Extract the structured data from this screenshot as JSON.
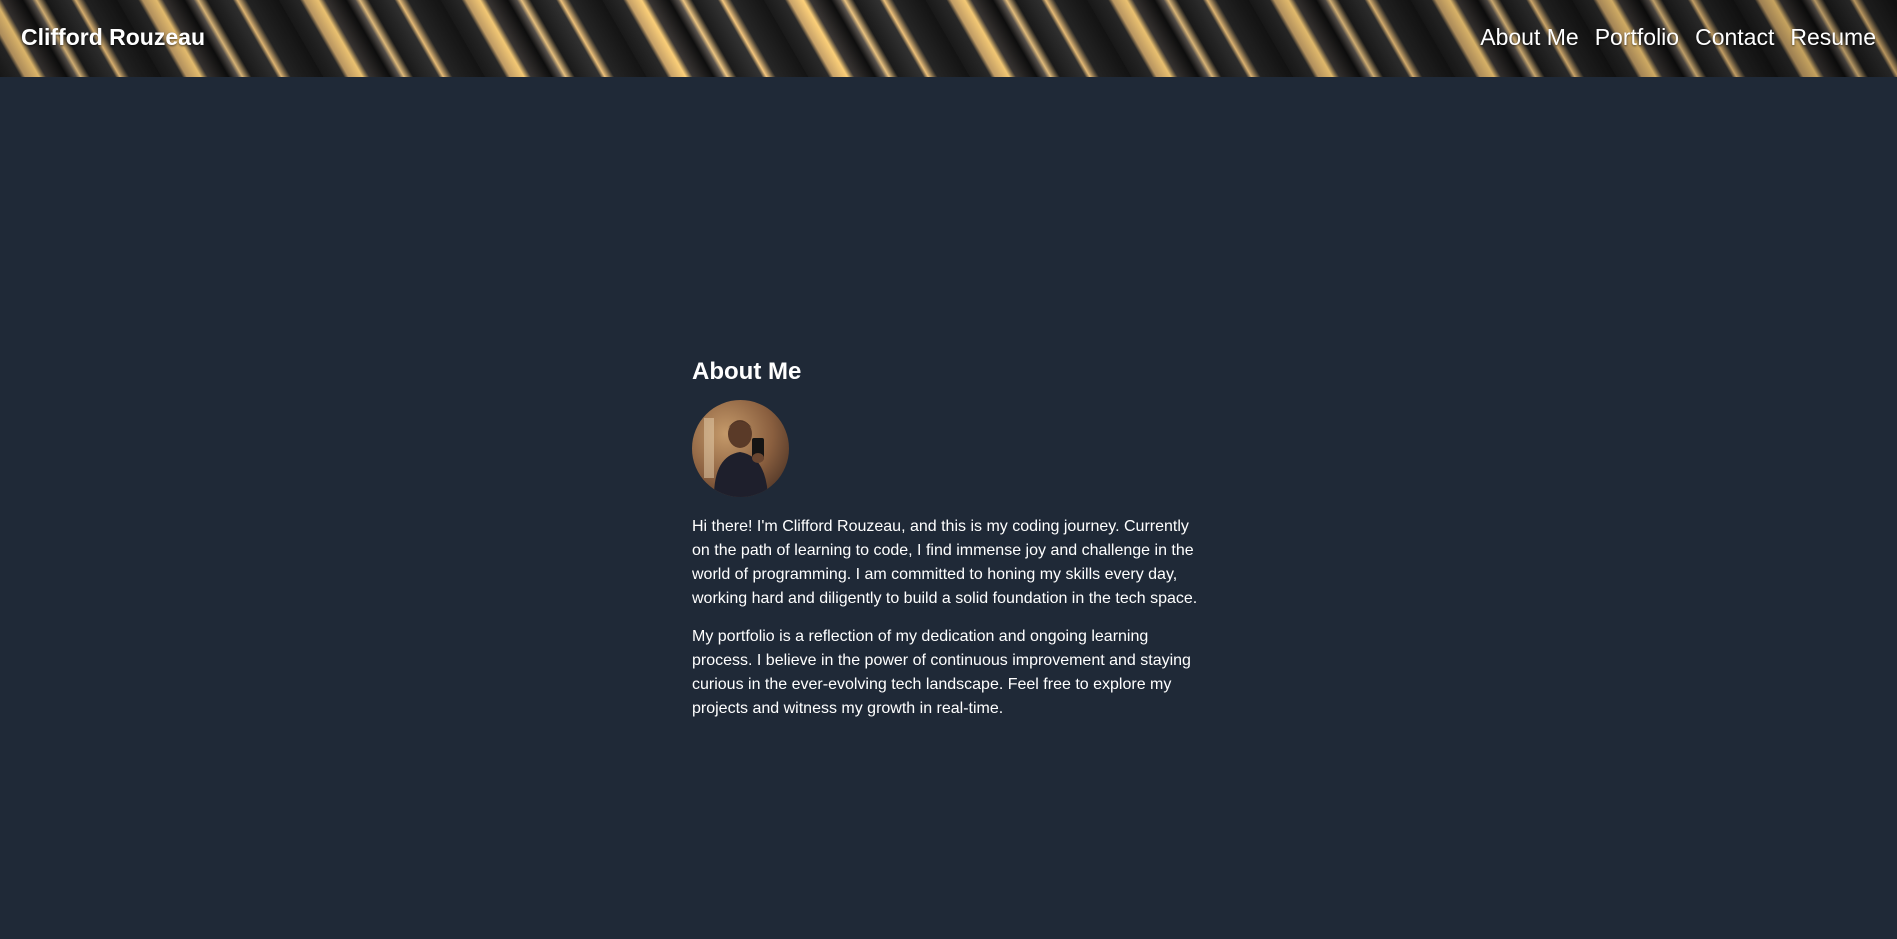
{
  "header": {
    "brand": "Clifford Rouzeau",
    "nav": [
      "About Me",
      "Portfolio",
      "Contact",
      "Resume"
    ]
  },
  "about": {
    "title": "About Me",
    "avatar_icon": "profile-photo",
    "paragraphs": [
      "Hi there! I'm Clifford Rouzeau, and this is my coding journey. Currently on the path of learning to code, I find immense joy and challenge in the world of programming. I am committed to honing my skills every day, working hard and diligently to build a solid foundation in the tech space.",
      "My portfolio is a reflection of my dedication and ongoing learning process. I believe in the power of continuous improvement and staying curious in the ever-evolving tech landscape. Feel free to explore my projects and witness my growth in real-time."
    ]
  },
  "colors": {
    "background": "#1f2937",
    "text": "#ffffff",
    "accent": "#ffd27a"
  }
}
